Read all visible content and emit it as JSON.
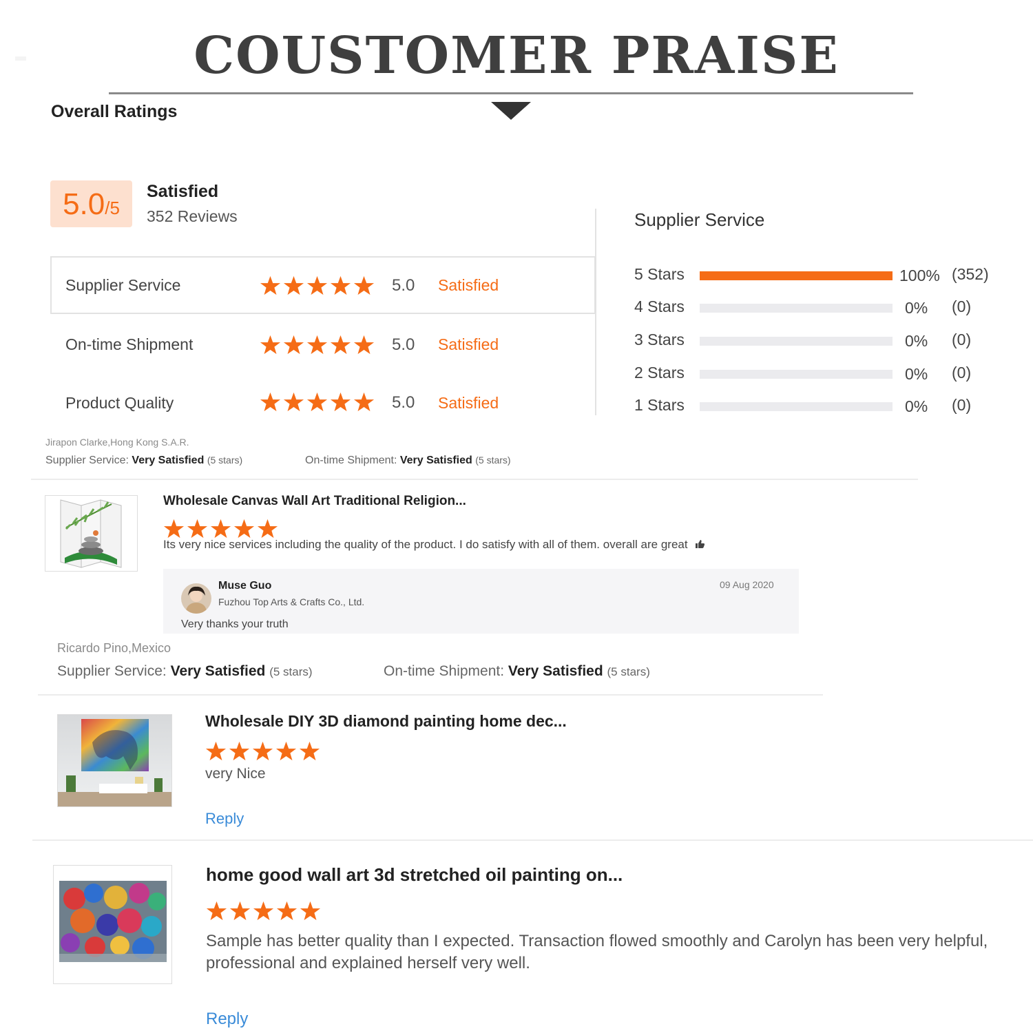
{
  "banner": {
    "title": "COUSTOMER PRAISE"
  },
  "overall": {
    "section_title": "Overall Ratings",
    "score": "5.0",
    "score_max": "/5",
    "label": "Satisfied",
    "reviews": "352 Reviews"
  },
  "ratings": [
    {
      "label": "Supplier Service",
      "stars": 5,
      "score": "5.0",
      "status": "Satisfied"
    },
    {
      "label": "On-time Shipment",
      "stars": 5,
      "score": "5.0",
      "status": "Satisfied"
    },
    {
      "label": "Product Quality",
      "stars": 5,
      "score": "5.0",
      "status": "Satisfied"
    }
  ],
  "distribution": {
    "title": "Supplier Service",
    "rows": [
      {
        "label": "5 Stars",
        "fraction": 1.0,
        "percent": "100%",
        "count": "(352)"
      },
      {
        "label": "4 Stars",
        "fraction": 0.0,
        "percent": "0%",
        "count": "(0)"
      },
      {
        "label": "3 Stars",
        "fraction": 0.0,
        "percent": "0%",
        "count": "(0)"
      },
      {
        "label": "2 Stars",
        "fraction": 0.0,
        "percent": "0%",
        "count": "(0)"
      },
      {
        "label": "1 Stars",
        "fraction": 0.0,
        "percent": "0%",
        "count": "(0)"
      }
    ]
  },
  "review1": {
    "reviewer": "Jirapon Clarke,Hong Kong S.A.R.",
    "supplier_label": "Supplier Service:",
    "supplier_value": "Very Satisfied",
    "supplier_stars": "(5 stars)",
    "shipment_label": "On-time Shipment:",
    "shipment_value": "Very Satisfied",
    "shipment_stars": "(5 stars)",
    "product_title": "Wholesale Canvas Wall Art Traditional Religion...",
    "stars": 5,
    "text": "Its very nice services including the quality of the product. I do satisfy with all of them. overall are great",
    "reply": {
      "name": "Muse Guo",
      "company": "Fuzhou Top Arts & Crafts Co., Ltd.",
      "date": "09 Aug 2020",
      "text": "Very thanks your truth"
    }
  },
  "review2": {
    "reviewer": "Ricardo Pino,Mexico",
    "supplier_label": "Supplier Service:",
    "supplier_value": "Very Satisfied",
    "supplier_stars": "(5 stars)",
    "shipment_label": "On-time Shipment:",
    "shipment_value": "Very Satisfied",
    "shipment_stars": "(5 stars)",
    "product_title": "Wholesale DIY 3D diamond painting home dec...",
    "stars": 5,
    "text": "very Nice",
    "reply_link": "Reply"
  },
  "review3": {
    "product_title": "home good wall art 3d stretched oil painting on...",
    "stars": 5,
    "text": "Sample has better quality than I expected. Transaction flowed smoothly and Carolyn has been very helpful, professional and explained herself very well.",
    "reply_link": "Reply"
  },
  "colors": {
    "accent": "#f56c16",
    "link": "#3a8bd8",
    "score_bg": "#fde0cf",
    "track": "#ebebee"
  }
}
